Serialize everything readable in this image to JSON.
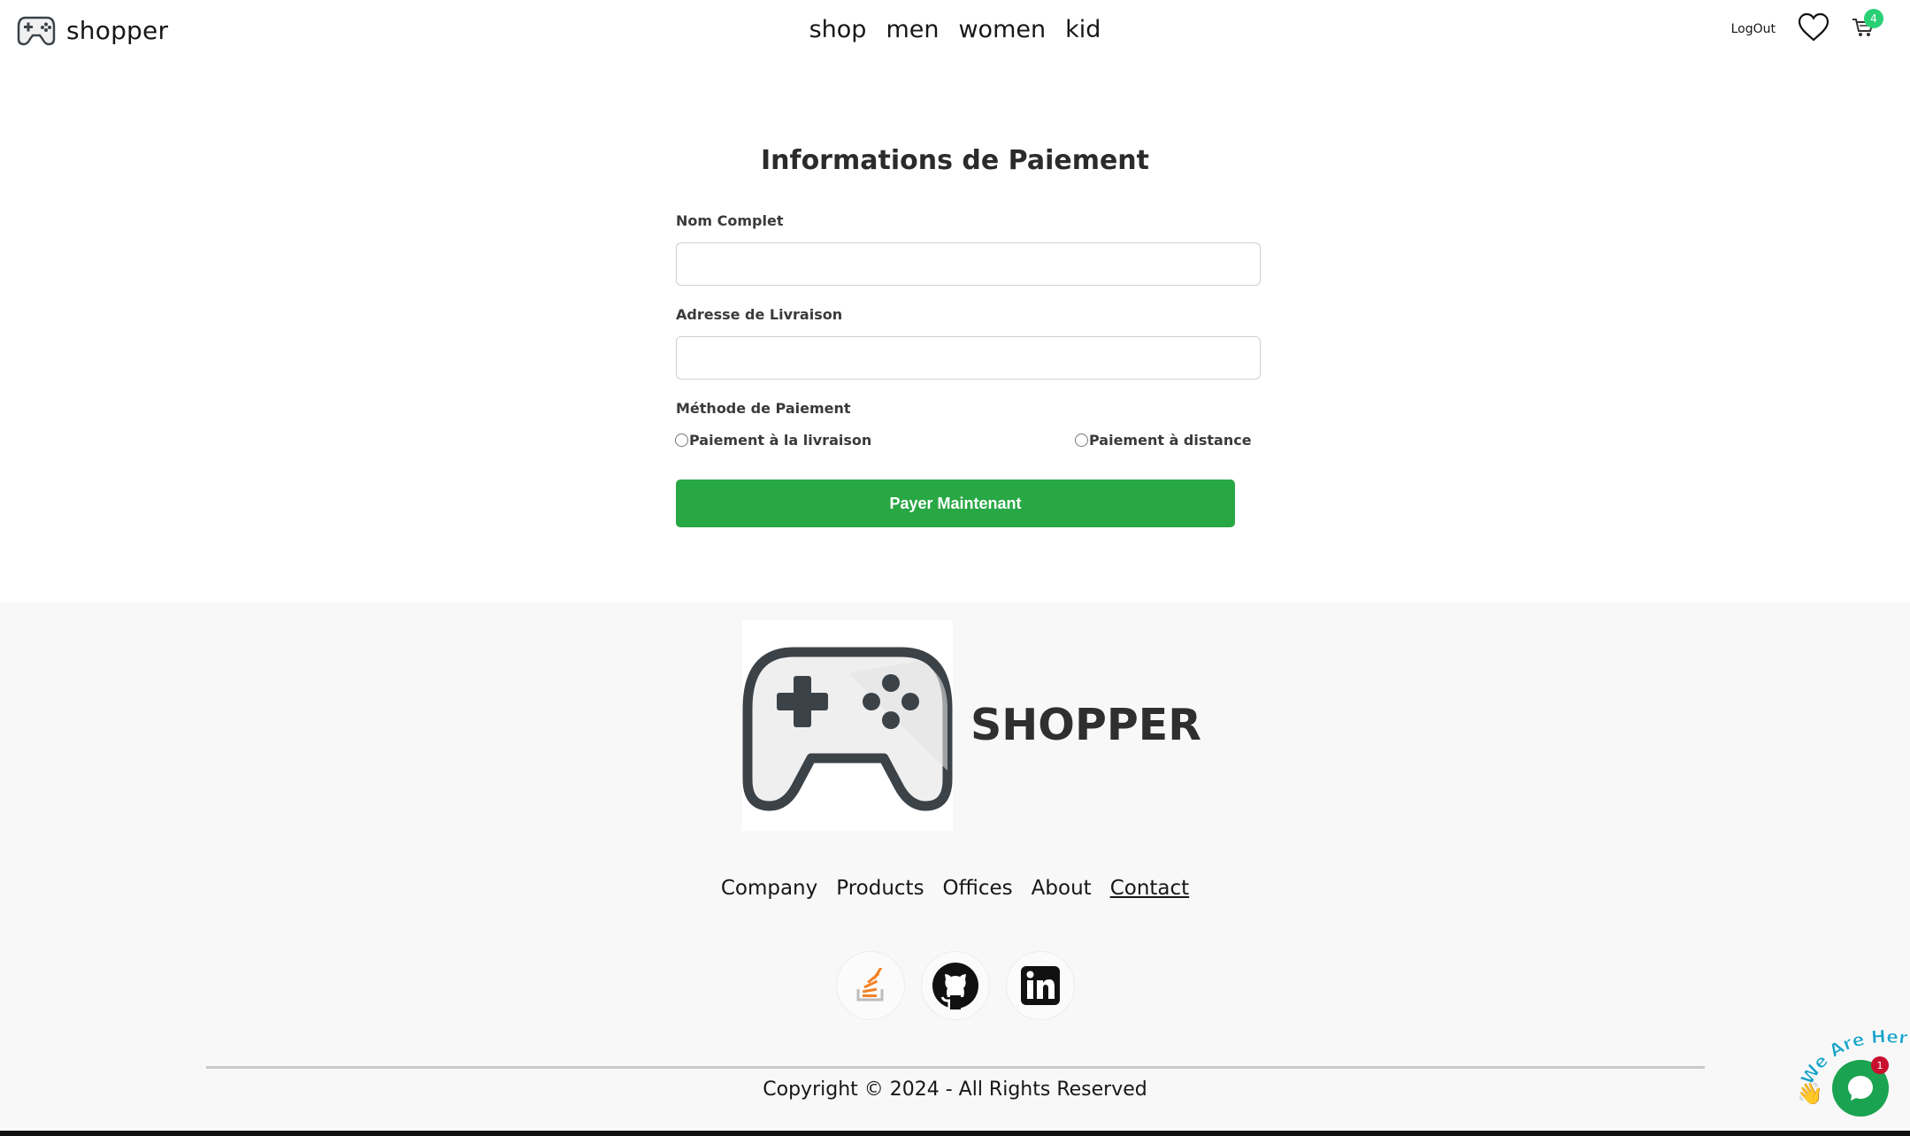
{
  "header": {
    "brand": "shopper",
    "nav": [
      "shop",
      "men",
      "women",
      "kid"
    ],
    "logout": "LogOut",
    "cart_count": "4"
  },
  "form": {
    "title": "Informations de Paiement",
    "name_label": "Nom Complet",
    "name_value": "",
    "address_label": "Adresse de Livraison",
    "address_value": "",
    "method_label": "Méthode de Paiement",
    "option_1": "Paiement à la livraison",
    "option_2": "Paiement à distance",
    "submit": "Payer Maintenant"
  },
  "footer": {
    "brand": "SHOPPER",
    "links": [
      "Company",
      "Products",
      "Offices",
      "About",
      "Contact"
    ],
    "socials": [
      "stackoverflow-icon",
      "github-icon",
      "linkedin-icon"
    ],
    "copyright": "Copyright © 2024 - All Rights Reserved"
  },
  "chat": {
    "banner": "We Are Here!",
    "badge": "1"
  },
  "colors": {
    "primary_button": "#28a745",
    "cart_badge": "#2ad174",
    "footer_bg": "#f8f8f8",
    "chat_bubble": "#1aa350"
  }
}
